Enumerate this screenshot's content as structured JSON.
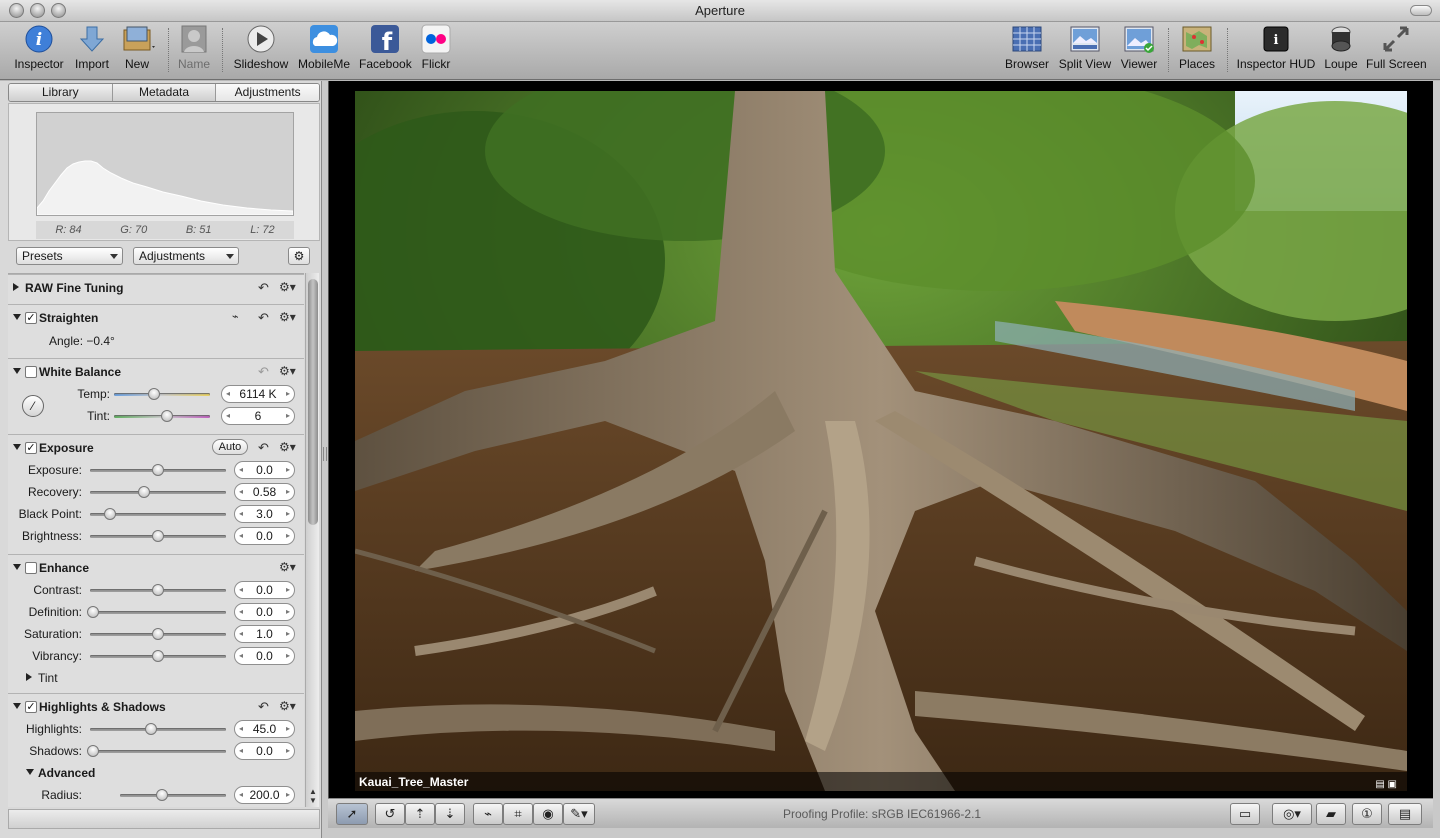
{
  "window": {
    "title": "Aperture"
  },
  "toolbar": {
    "left": [
      {
        "label": "Inspector",
        "icon": "info-icon"
      },
      {
        "label": "Import",
        "icon": "import-arrow-icon"
      },
      {
        "label": "New",
        "icon": "new-project-icon"
      },
      {
        "label": "Name",
        "icon": "name-person-icon"
      },
      {
        "label": "Slideshow",
        "icon": "play-icon"
      },
      {
        "label": "MobileMe",
        "icon": "cloud-icon"
      },
      {
        "label": "Facebook",
        "icon": "facebook-icon"
      },
      {
        "label": "Flickr",
        "icon": "flickr-icon"
      }
    ],
    "right": [
      {
        "label": "Browser",
        "icon": "browser-grid-icon"
      },
      {
        "label": "Split View",
        "icon": "split-view-icon"
      },
      {
        "label": "Viewer",
        "icon": "viewer-icon"
      },
      {
        "label": "Places",
        "icon": "map-icon"
      },
      {
        "label": "Inspector HUD",
        "icon": "hud-icon"
      },
      {
        "label": "Loupe",
        "icon": "loupe-icon"
      },
      {
        "label": "Full Screen",
        "icon": "full-screen-icon"
      }
    ]
  },
  "inspector": {
    "tabs": [
      "Library",
      "Metadata",
      "Adjustments"
    ],
    "active_tab": "Adjustments",
    "readout": {
      "r": "R: 84",
      "g": "G: 70",
      "b": "B: 51",
      "l": "L: 72"
    },
    "presets_label": "Presets",
    "adjustments_label": "Adjustments"
  },
  "adjustments": {
    "raw": {
      "title": "RAW Fine Tuning"
    },
    "straighten": {
      "title": "Straighten",
      "angle": "Angle: −0.4°"
    },
    "white_balance": {
      "title": "White Balance",
      "temp_label": "Temp:",
      "temp_value": "6114 K",
      "temp_level": 0.42,
      "tint_label": "Tint:",
      "tint_value": "6",
      "tint_level": 0.55
    },
    "exposure": {
      "title": "Exposure",
      "auto_label": "Auto",
      "rows": [
        {
          "label": "Exposure:",
          "value": "0.0",
          "level": 0.5
        },
        {
          "label": "Recovery:",
          "value": "0.58",
          "level": 0.4
        },
        {
          "label": "Black Point:",
          "value": "3.0",
          "level": 0.15
        },
        {
          "label": "Brightness:",
          "value": "0.0",
          "level": 0.5
        }
      ]
    },
    "enhance": {
      "title": "Enhance",
      "rows": [
        {
          "label": "Contrast:",
          "value": "0.0",
          "level": 0.5
        },
        {
          "label": "Definition:",
          "value": "0.0",
          "level": 0.02
        },
        {
          "label": "Saturation:",
          "value": "1.0",
          "level": 0.5
        },
        {
          "label": "Vibrancy:",
          "value": "0.0",
          "level": 0.5
        }
      ],
      "tint_label": "Tint"
    },
    "highlights_shadows": {
      "title": "Highlights & Shadows",
      "rows": [
        {
          "label": "Highlights:",
          "value": "45.0",
          "level": 0.45
        },
        {
          "label": "Shadows:",
          "value": "0.0",
          "level": 0.02
        }
      ],
      "advanced_label": "Advanced",
      "radius_label": "Radius:",
      "radius_value": "200.0",
      "radius_level": 0.4
    }
  },
  "viewer": {
    "image_name": "Kauai_Tree_Master",
    "proofing": "Proofing Profile: sRGB IEC61966-2.1"
  }
}
